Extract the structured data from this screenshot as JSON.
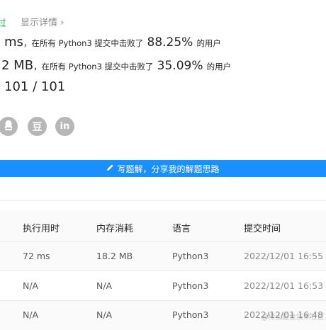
{
  "result": {
    "status": "过",
    "detail_link": "显示详情 ›"
  },
  "runtime": {
    "value": "ms",
    "prefix": "，在所有 Python3 提交中击败了",
    "percent": "88.25%",
    "suffix": "的用户"
  },
  "memory": {
    "value": "2 MB",
    "prefix": "，在所有 Python3 提交中击败了",
    "percent": "35.09%",
    "suffix": "的用户"
  },
  "testcases": "101 / 101",
  "share": {
    "icons": [
      "qq-icon",
      "douban-icon",
      "linkedin-icon"
    ],
    "douban_label": "豆",
    "linkedin_label": "in"
  },
  "write_solution": {
    "icon": "pencil-icon",
    "label": "写题解，分享我的解题思路"
  },
  "table": {
    "headers": [
      "执行用时",
      "内存消耗",
      "语言",
      "提交时间"
    ],
    "rows": [
      {
        "runtime": "72 ms",
        "memory": "18.2 MB",
        "language": "Python3",
        "time": "2022/12/01 16:55"
      },
      {
        "runtime": "N/A",
        "memory": "N/A",
        "language": "Python3",
        "time": "2022/12/01 16:53"
      },
      {
        "runtime": "N/A",
        "memory": "N/A",
        "language": "Python3",
        "time": "2022/12/01 16:48"
      }
    ]
  },
  "watermark": "@稀土掘金技术社区",
  "colors": {
    "accent": "#1a90ff",
    "success": "#2db55d",
    "icon_gray": "#b7b7b7"
  }
}
